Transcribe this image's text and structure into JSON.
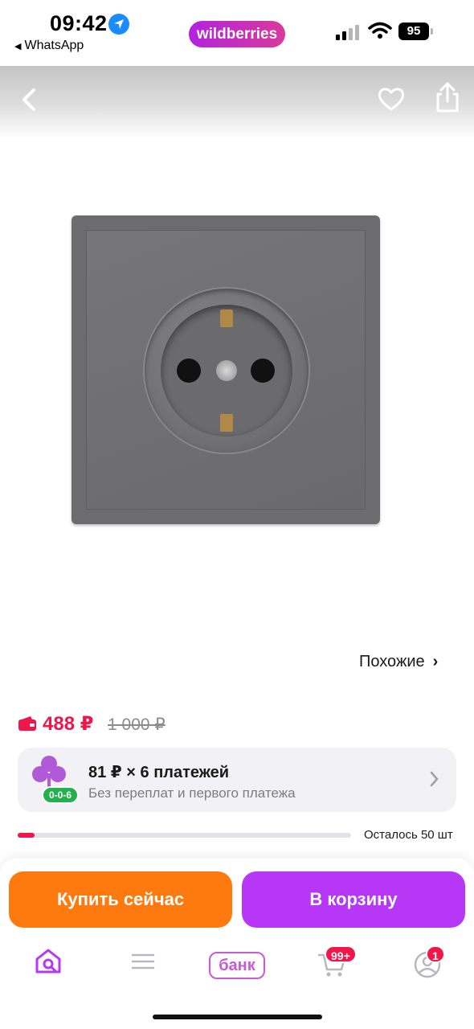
{
  "status_bar": {
    "time": "09:42",
    "back_app": "WhatsApp",
    "brand_pill": "wildberries",
    "battery": "95",
    "icons": [
      "location-arrow-icon",
      "cellular-signal-icon",
      "wifi-icon",
      "battery-icon"
    ]
  },
  "header": {
    "icons": [
      "back-arrow-icon",
      "heart-icon",
      "share-icon"
    ]
  },
  "product": {
    "similar_label": "Похожие",
    "price": "488 ₽",
    "old_price": "1 000 ₽"
  },
  "installment": {
    "badge": "0-0-6",
    "title": "81 ₽ × 6 платежей",
    "subtitle": "Без переплат и первого платежа"
  },
  "stock": {
    "text": "Осталось 50 шт",
    "level_fraction": 0.05
  },
  "actions": {
    "buy_now": "Купить сейчас",
    "add_to_cart": "В корзину"
  },
  "tab_bar": {
    "bank_label": "банк",
    "cart_badge": "99+",
    "profile_badge": "1",
    "icons": [
      "home-search-icon",
      "menu-icon",
      "bank-icon",
      "cart-icon",
      "profile-icon"
    ]
  },
  "colors": {
    "price": "#f0164a",
    "buy_button": "#ff7a0e",
    "cart_button": "#b637f5",
    "brand": "#c85ad6"
  }
}
